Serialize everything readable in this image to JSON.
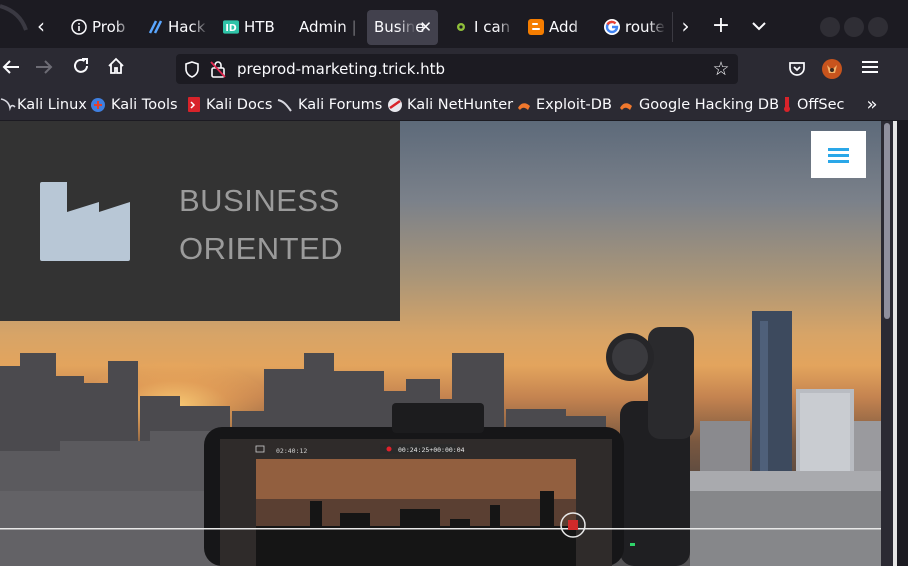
{
  "tabs": [
    {
      "title": "Prob",
      "icon": "info-icon",
      "active": false
    },
    {
      "title": "Hack",
      "icon": "hackthebox-slash-icon",
      "active": false
    },
    {
      "title": "HTB",
      "icon": "id-badge-icon",
      "active": false
    },
    {
      "title": "Admin |",
      "icon": "",
      "active": false
    },
    {
      "title": "Busine",
      "icon": "",
      "active": true
    },
    {
      "title": "I can",
      "icon": "bug-icon",
      "active": false
    },
    {
      "title": "Add",
      "icon": "blogger-icon",
      "active": false
    },
    {
      "title": "route",
      "icon": "google-icon",
      "active": false
    }
  ],
  "navbar": {
    "url": "preprod-marketing.trick.htb"
  },
  "bookmarks": [
    {
      "label": "Kali Linux",
      "icon": "kali-dragon-icon"
    },
    {
      "label": "Kali Tools",
      "icon": "kali-tools-icon"
    },
    {
      "label": "Kali Docs",
      "icon": "kali-docs-icon"
    },
    {
      "label": "Kali Forums",
      "icon": "kali-forums-icon"
    },
    {
      "label": "Kali NetHunter",
      "icon": "nethunter-icon"
    },
    {
      "label": "Exploit-DB",
      "icon": "exploit-db-icon"
    },
    {
      "label": "Google Hacking DB",
      "icon": "ghdb-icon"
    },
    {
      "label": "OffSec",
      "icon": "offsec-icon"
    }
  ],
  "page": {
    "brand_line1": "BUSINESS",
    "brand_line2": "ORIENTED",
    "phone_clock": "02:40:12",
    "phone_rec": "00:24:25+00:00:04"
  },
  "colors": {
    "tab_strip": "#1c1b22",
    "toolbar": "#2b2a33",
    "active_tab": "#42414d",
    "hero_panel": "#333333",
    "factory_icon": "#b8c7d6",
    "brand_text": "#9b9b9b",
    "hamburger_accent": "#2aa7e8"
  }
}
